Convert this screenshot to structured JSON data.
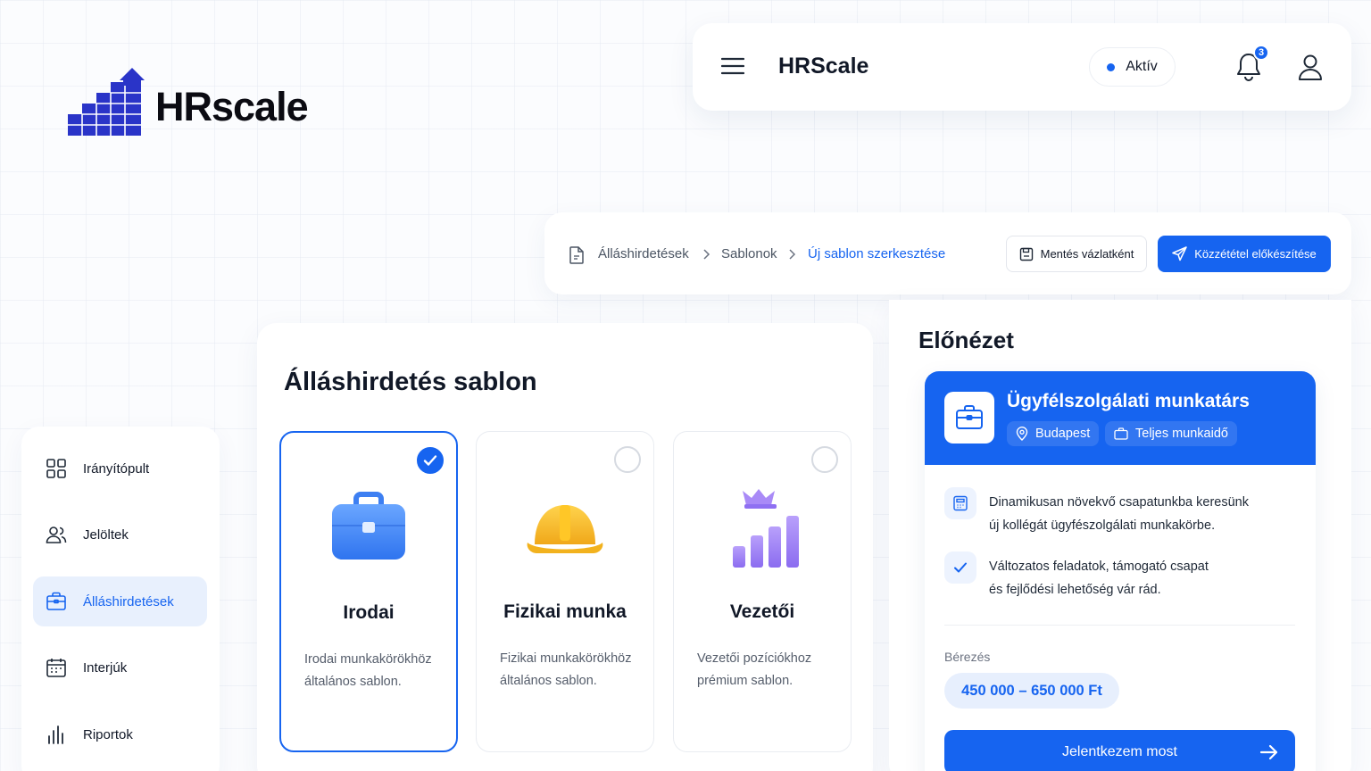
{
  "logo": {
    "text": "HRscale"
  },
  "topbar": {
    "app_name": "HRScale",
    "status": "Aktív",
    "notification_count": "3"
  },
  "breadcrumb": {
    "items": [
      "Álláshirdetések",
      "Sablonok",
      "Új sablon szerkesztése"
    ]
  },
  "actions": {
    "save_draft": "Mentés vázlatként",
    "prepare_publish": "Közzététel előkészítése"
  },
  "sidebar": {
    "items": [
      {
        "label": "Irányítópult",
        "icon": "grid-icon"
      },
      {
        "label": "Jelöltek",
        "icon": "users-icon"
      },
      {
        "label": "Álláshirdetések",
        "icon": "briefcase-icon",
        "active": true
      },
      {
        "label": "Interjúk",
        "icon": "calendar-icon"
      },
      {
        "label": "Riportok",
        "icon": "bar-chart-icon"
      }
    ]
  },
  "template": {
    "title": "Álláshirdetés sablon",
    "cards": [
      {
        "name": "Irodai",
        "desc_line1": "Irodai munkakörökhöz",
        "desc_line2": "általános sablon.",
        "selected": true,
        "icon": "briefcase-3d-icon"
      },
      {
        "name": "Fizikai munka",
        "desc_line1": "Fizikai munkakörökhöz",
        "desc_line2": "általános sablon.",
        "selected": false,
        "icon": "hard-hat-icon"
      },
      {
        "name": "Vezetői",
        "desc_line1": "Vezetői pozíciókhoz",
        "desc_line2": "prémium sablon.",
        "selected": false,
        "icon": "crown-chart-icon"
      }
    ]
  },
  "preview": {
    "title": "Előnézet",
    "job_title": "Ügyfélszolgálati munkatárs",
    "location": "Budapest",
    "schedule": "Teljes munkaidő",
    "features": [
      {
        "line1": "Dinamikusan növekvő csapatunkba keresünk",
        "line2": "új kollégát ügyfészolgálati munkakörbe."
      },
      {
        "line1": "Változatos feladatok, támogató csapat",
        "line2": "és fejlődési lehetőség vár rád."
      }
    ],
    "salary_label": "Bérezés",
    "salary_value": "450 000 – 650 000 Ft",
    "apply_label": "Jelentkezem most"
  },
  "colors": {
    "accent": "#1664f0",
    "accent_light": "#e8f0fd"
  }
}
